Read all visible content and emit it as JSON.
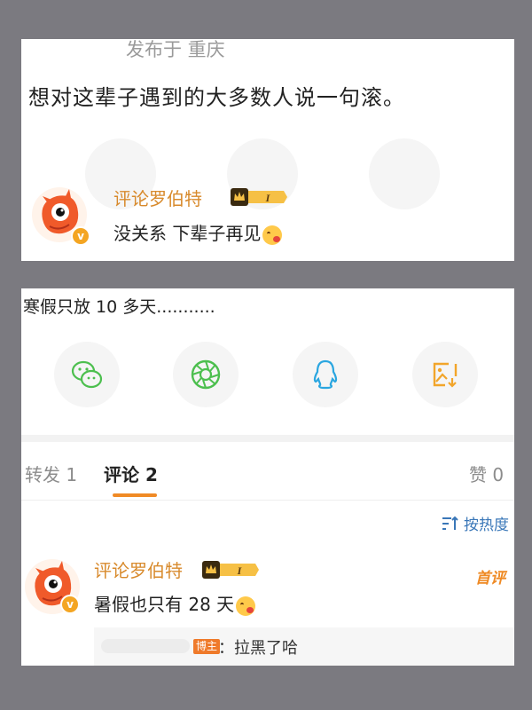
{
  "post1": {
    "location": "发布于 重庆",
    "text": "想对这辈子遇到的大多数人说一句滚。",
    "comment": {
      "username": "评论罗伯特",
      "rank_badge": "I",
      "text": "没关系 下辈子再见",
      "emoji": "tongue-emoji"
    }
  },
  "post2": {
    "text": "寒假只放 10 多天...........",
    "share_icons": [
      "wechat-icon",
      "moments-icon",
      "qq-icon",
      "save-image-icon"
    ],
    "tabs": {
      "repost": "转发 1",
      "comment": "评论 2",
      "like": "赞 0"
    },
    "sort_label": "按热度",
    "comment": {
      "username": "评论罗伯特",
      "rank_badge": "I",
      "first_label": "首评",
      "text": "暑假也只有 28 天",
      "emoji": "tongue-emoji"
    },
    "reply": {
      "author_badge": "博主",
      "text": "：拉黑了哈"
    }
  },
  "colors": {
    "accent": "#f08a25",
    "username": "#d88a2c",
    "link": "#3a77b8",
    "background": "#7b7a80"
  }
}
